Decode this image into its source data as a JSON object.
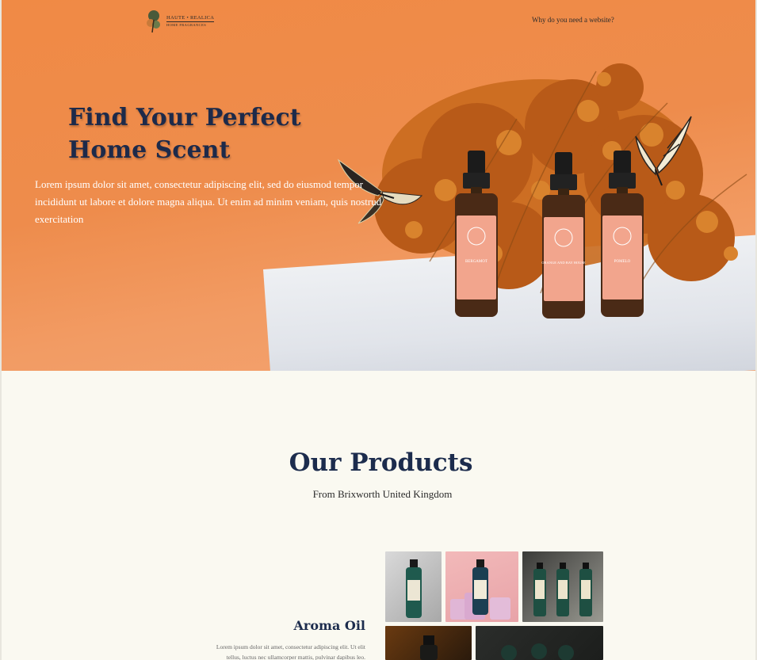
{
  "header": {
    "logo": {
      "brand": "HAUTE • REALICA",
      "subtitle": "HOME FRAGRANCES"
    },
    "nav": {
      "link_label": "Why do you need a website?"
    }
  },
  "hero": {
    "title_line1": "Find Your Perfect",
    "title_line2": "Home Scent",
    "text": "Lorem ipsum dolor sit amet, consectetur adipiscing elit, sed do eiusmod tempor incididunt ut labore et dolore magna aliqua. Ut enim ad minim veniam, quis nostrud exercitation",
    "bottle_labels": [
      "BERGAMOT",
      "ORANGE AND BAY HOUSE",
      "POMELO"
    ]
  },
  "products": {
    "title": "Our Products",
    "subtitle": "From Brixworth United Kingdom",
    "items": [
      {
        "name": "Aroma Oil",
        "description_line1": "Lorem ipsum dolor sit amet, consectetur adipiscing elit. Ut elit",
        "description_line2": "tellus, luctus nec ullamcorper mattis, pulvinar dapibus leo."
      }
    ]
  },
  "colors": {
    "hero_orange": "#f08a45",
    "navy": "#1c2c4d",
    "page_bg": "#faf9f1"
  }
}
